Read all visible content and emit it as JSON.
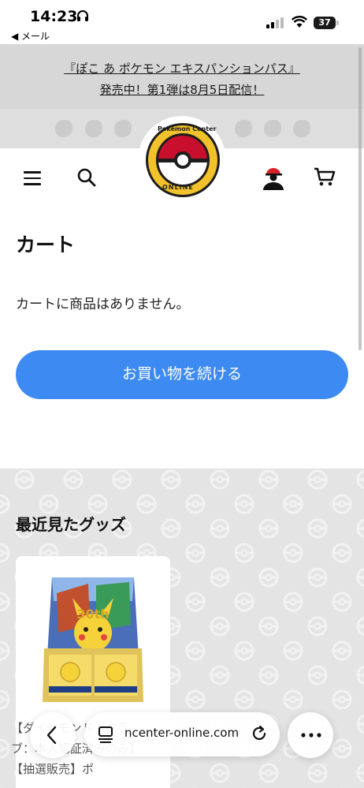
{
  "status_bar": {
    "time": "14:23",
    "back_app": "◀ メール",
    "battery": "37"
  },
  "announcement": {
    "line1": "『ぽこ あ ポケモン エキスパンションパス』",
    "line2": "発売中！第1弾は8月5日配信！"
  },
  "header": {
    "logo_top": "Pokémon Center",
    "logo_bottom": "ONLINE"
  },
  "cart": {
    "title": "カート",
    "empty_message": "カートに商品はありません。",
    "continue_label": "お買い物を続ける"
  },
  "recent": {
    "title": "最近見たグッズ",
    "product_text": "【ダイヤモンド・クラブ：本人認証済みのみ】【抽選販売】ポ"
  },
  "browser": {
    "url": "ncenter-online.com"
  },
  "colors": {
    "accent": "#3d8bf2",
    "banner_bg": "#d7d7d7",
    "section_bg": "#e4e4e4"
  }
}
